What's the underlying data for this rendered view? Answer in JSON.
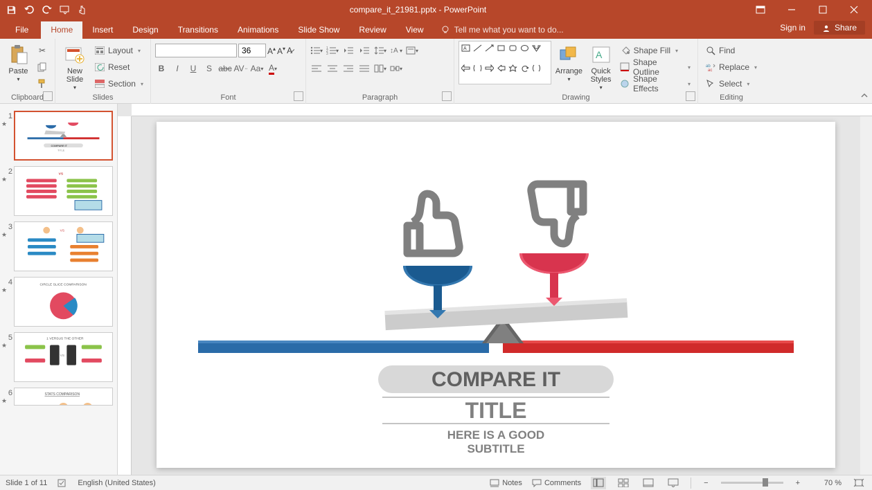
{
  "title": "compare_it_21981.pptx - PowerPoint",
  "tabs": {
    "file": "File",
    "home": "Home",
    "insert": "Insert",
    "design": "Design",
    "transitions": "Transitions",
    "animations": "Animations",
    "slideshow": "Slide Show",
    "review": "Review",
    "view": "View"
  },
  "tell_me": "Tell me what you want to do...",
  "signin": "Sign in",
  "share": "Share",
  "ribbon": {
    "clipboard": {
      "label": "Clipboard",
      "paste": "Paste"
    },
    "slides": {
      "label": "Slides",
      "new_slide": "New\nSlide",
      "layout": "Layout",
      "reset": "Reset",
      "section": "Section"
    },
    "font": {
      "label": "Font",
      "size": "36"
    },
    "paragraph": {
      "label": "Paragraph"
    },
    "drawing": {
      "label": "Drawing",
      "arrange": "Arrange",
      "quick_styles": "Quick\nStyles",
      "shape_fill": "Shape Fill",
      "shape_outline": "Shape Outline",
      "shape_effects": "Shape Effects"
    },
    "editing": {
      "label": "Editing",
      "find": "Find",
      "replace": "Replace",
      "select": "Select"
    }
  },
  "thumbnails": [
    {
      "num": "1"
    },
    {
      "num": "2"
    },
    {
      "num": "3"
    },
    {
      "num": "4",
      "cap": "CIRCLE SLICE COMPARISON"
    },
    {
      "num": "5",
      "cap": "1 VERSUS THE OTHER"
    },
    {
      "num": "6",
      "cap": "STATS COMPARISON"
    }
  ],
  "slide": {
    "compare": "COMPARE IT",
    "title": "TITLE",
    "sub1": "HERE IS A GOOD",
    "sub2": "SUBTITLE"
  },
  "status": {
    "slide": "Slide 1 of 11",
    "lang": "English (United States)",
    "notes": "Notes",
    "comments": "Comments",
    "zoom": "70 %"
  }
}
